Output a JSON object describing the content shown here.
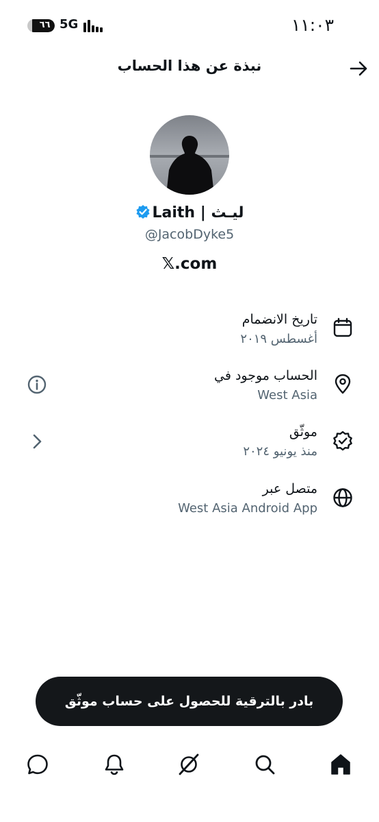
{
  "status_bar": {
    "time": "١١:٠٣",
    "battery": "٦٦",
    "network": "5G"
  },
  "header": {
    "title": "نبذة عن هذا الحساب",
    "back_icon": "arrow-right-icon"
  },
  "profile": {
    "display_name": "Laith | ليـث",
    "handle": "@JacobDyke5",
    "site": "𝕏.com",
    "verified_color": "#1d9bf0"
  },
  "details": [
    {
      "title": "تاريخ الانضمام",
      "value": "أغسطس ٢٠١٩",
      "icon": "calendar-icon"
    },
    {
      "title": "الحساب موجود في",
      "value": "West Asia",
      "icon": "location-pin-icon",
      "aux_icon": "info-icon"
    },
    {
      "title": "موثّق",
      "value": "منذ يونيو ٢٠٢٤",
      "icon": "verified-badge-icon",
      "aux_icon": "chevron-right-icon"
    },
    {
      "title": "متصل عبر",
      "value": "West Asia Android App",
      "icon": "globe-icon"
    }
  ],
  "upgrade_button": "بادر بالترقية للحصول على حساب موثّق",
  "bottom_nav": [
    "messages-icon",
    "notifications-icon",
    "grok-icon",
    "search-icon",
    "home-icon"
  ]
}
